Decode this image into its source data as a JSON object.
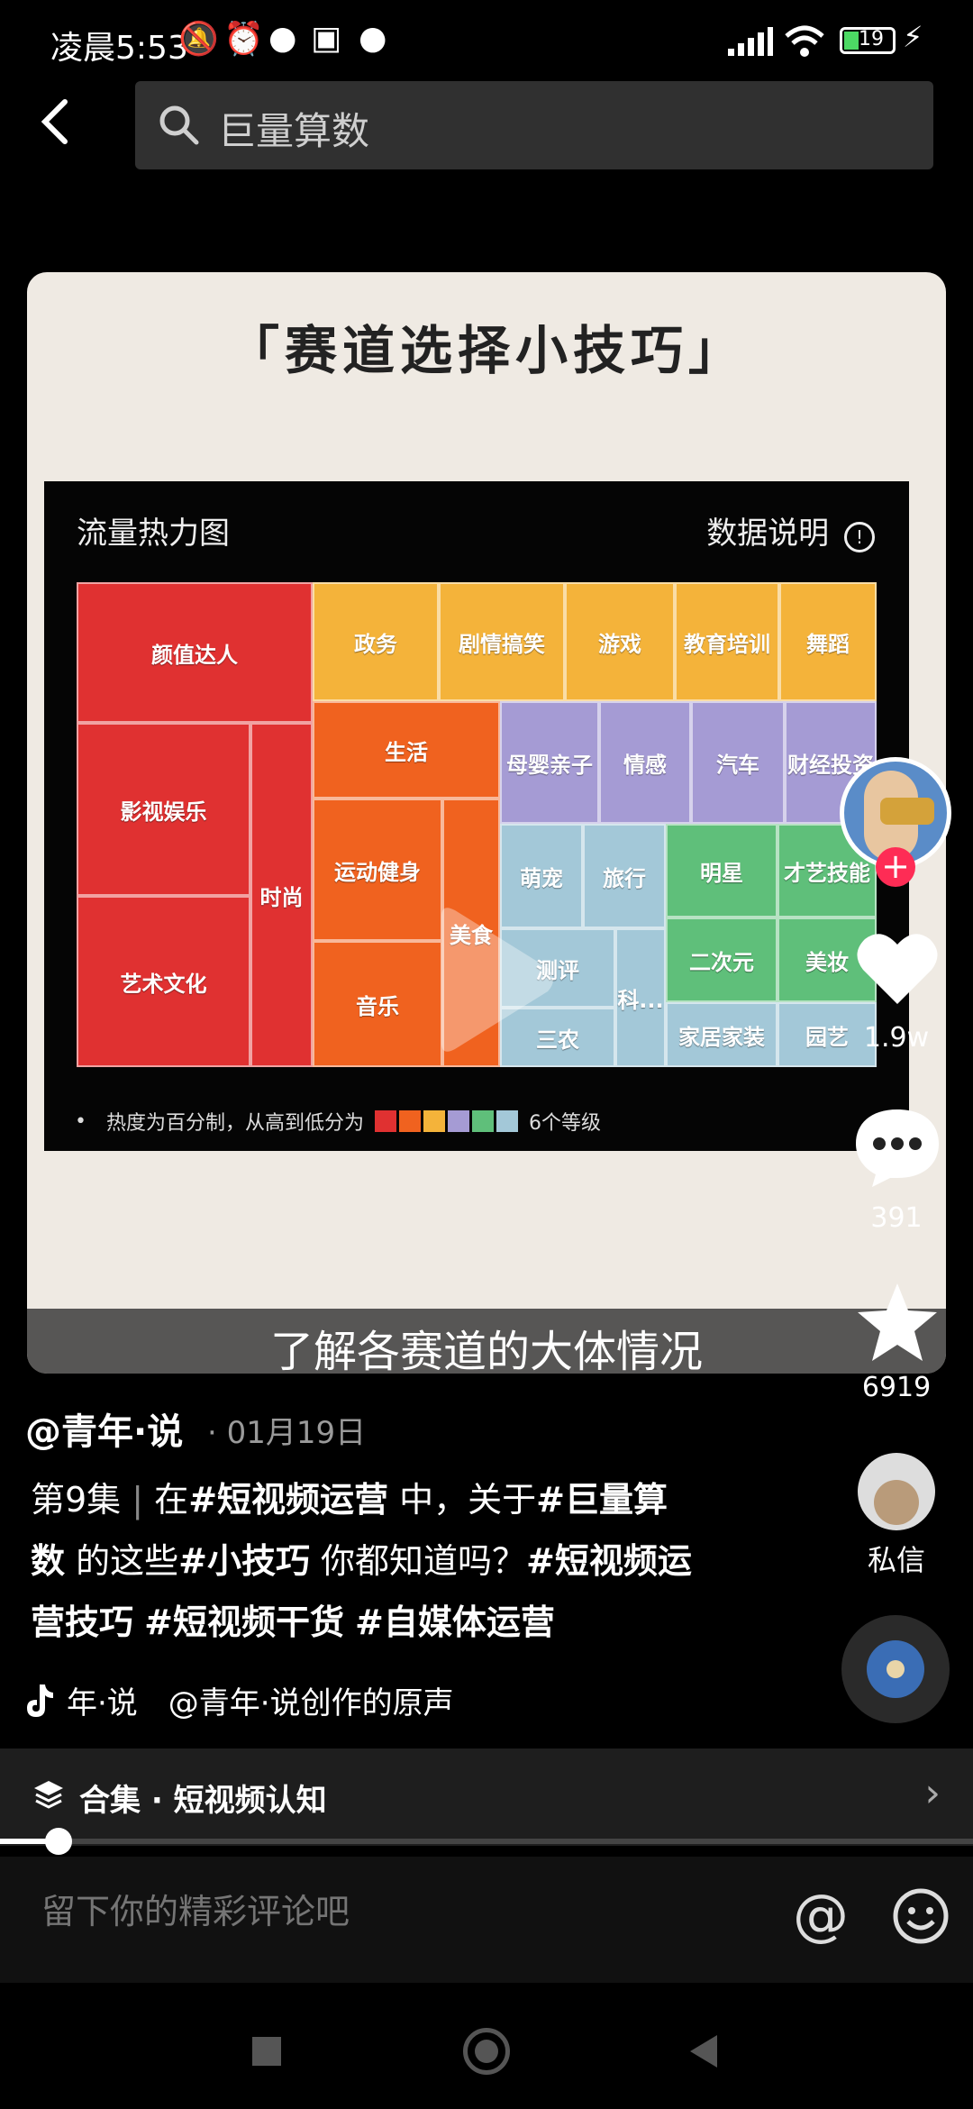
{
  "status_bar": {
    "time": "凌晨5:53",
    "battery": "19"
  },
  "search": {
    "query": "巨量算数"
  },
  "video": {
    "title": "「赛道选择小技巧」",
    "heatmap_title": "流量热力图",
    "data_note": "数据说明",
    "subtitle": "了解各赛道的大体情况",
    "legend_text_before": "热度为百分制，从高到低分为",
    "legend_text_after": "6个等级",
    "legend_colors": [
      "#e03131",
      "#f0621f",
      "#f4b33a",
      "#a59bd4",
      "#5fbf7a",
      "#a3c8d8"
    ]
  },
  "chart_data": {
    "type": "heatmap",
    "title": "流量热力图",
    "levels": 6,
    "categories": [
      {
        "label": "颜值达人",
        "level": 1
      },
      {
        "label": "影视娱乐",
        "level": 1
      },
      {
        "label": "艺术文化",
        "level": 1
      },
      {
        "label": "时尚",
        "level": 1
      },
      {
        "label": "政务",
        "level": 3
      },
      {
        "label": "剧情搞笑",
        "level": 3
      },
      {
        "label": "游戏",
        "level": 3
      },
      {
        "label": "教育培训",
        "level": 3
      },
      {
        "label": "舞蹈",
        "level": 3
      },
      {
        "label": "生活",
        "level": 2
      },
      {
        "label": "运动健身",
        "level": 2
      },
      {
        "label": "音乐",
        "level": 2
      },
      {
        "label": "美食",
        "level": 2
      },
      {
        "label": "母婴亲子",
        "level": 4
      },
      {
        "label": "情感",
        "level": 4
      },
      {
        "label": "汽车",
        "level": 4
      },
      {
        "label": "财经投资",
        "level": 4
      },
      {
        "label": "萌宠",
        "level": 6
      },
      {
        "label": "旅行",
        "level": 6
      },
      {
        "label": "测评",
        "level": 6
      },
      {
        "label": "科...",
        "level": 6
      },
      {
        "label": "三农",
        "level": 6
      },
      {
        "label": "明星",
        "level": 5
      },
      {
        "label": "才艺技能",
        "level": 5
      },
      {
        "label": "二次元",
        "level": 5
      },
      {
        "label": "美妆",
        "level": 5
      },
      {
        "label": "家居家装",
        "level": 6
      },
      {
        "label": "园艺",
        "level": 6
      }
    ]
  },
  "actions": {
    "likes": "1.9w",
    "comments": "391",
    "favorites": "6919",
    "dm_label": "私信"
  },
  "post": {
    "author": "@青年·说",
    "date": "· 01月19日",
    "episode": "第9集",
    "separator": "|",
    "text_1": " 在",
    "tag_1": "#短视频运营",
    "text_2": " 中，关于",
    "tag_2": "#巨量算数",
    "text_3": " 的这些",
    "tag_3": "#小技巧",
    "text_4": " 你都知道吗？",
    "tag_4": "#短视频运营技巧",
    "tag_5": "#短视频干货",
    "tag_6": "#自媒体运营",
    "music": "年·说　@青年·说创作的原声"
  },
  "collection": {
    "label": "合集 · 短视频认知"
  },
  "progress": 0.06,
  "comment": {
    "placeholder": "留下你的精彩评论吧"
  },
  "icons": [
    "back-icon",
    "search-icon",
    "play-icon",
    "heart-icon",
    "comment-icon",
    "star-icon",
    "at-icon",
    "emoji-icon",
    "layers-icon",
    "chevron-right-icon",
    "tiktok-icon"
  ]
}
